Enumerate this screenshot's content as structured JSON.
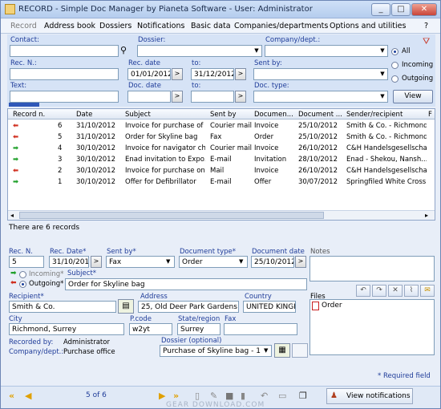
{
  "window": {
    "title": "RECORD - Simple Doc Manager by Pianeta Software - User: Administrator",
    "min": "_",
    "max": "□",
    "close": "✕"
  },
  "menu": [
    "Record",
    "Address book",
    "Dossiers",
    "Notifications",
    "Basic data",
    "Companies/departments",
    "Options and utilities",
    "?"
  ],
  "filter": {
    "contact_label": "Contact:",
    "dossier_label": "Dossier:",
    "company_label": "Company/dept.:",
    "recn_label": "Rec. N.:",
    "recdate_label": "Rec. date",
    "to_label": "to:",
    "sentby_label": "Sent by:",
    "text_label": "Text:",
    "docdate_label": "Doc. date",
    "to_label2": "to:",
    "doctype_label": "Doc. type:",
    "recdate_from": "01/01/2012",
    "recdate_to": "31/12/2012",
    "radio_all": "All",
    "radio_incoming": "Incoming",
    "radio_outgoing": "Outgoing",
    "view_button": "View"
  },
  "grid": {
    "columns": [
      "Record n.",
      "Date",
      "Subject",
      "Sent by",
      "Documen...",
      "Document ...",
      "Sender/recipient",
      "F"
    ],
    "rows": [
      {
        "dir": "out",
        "n": "6",
        "date": "31/10/2012",
        "subject": "Invoice for purchase of ...",
        "sentby": "Courier mail",
        "doctype": "Invoice",
        "docdate": "25/10/2012",
        "sender": "Smith & Co. - Richmond..."
      },
      {
        "dir": "out",
        "n": "5",
        "date": "31/10/2012",
        "subject": "Order for Skyline bag",
        "sentby": "Fax",
        "doctype": "Order",
        "docdate": "25/10/2012",
        "sender": "Smith & Co. - Richmond..."
      },
      {
        "dir": "in",
        "n": "4",
        "date": "30/10/2012",
        "subject": "Invoice for navigator ch...",
        "sentby": "Courier mail",
        "doctype": "Invoice",
        "docdate": "26/10/2012",
        "sender": "C&H Handelsgesellscha..."
      },
      {
        "dir": "in",
        "n": "3",
        "date": "30/10/2012",
        "subject": "Enad invitation to Expo...",
        "sentby": "E-mail",
        "doctype": "Invitation",
        "docdate": "28/10/2012",
        "sender": "Enad - Shekou, Nansh..."
      },
      {
        "dir": "out",
        "n": "2",
        "date": "30/10/2012",
        "subject": "Invoice for purchase on ...",
        "sentby": "Mail",
        "doctype": "Invoice",
        "docdate": "26/10/2012",
        "sender": "C&H Handelsgesellscha..."
      },
      {
        "dir": "in",
        "n": "1",
        "date": "30/10/2012",
        "subject": "Offer for Defibrillator",
        "sentby": "E-mail",
        "doctype": "Offer",
        "docdate": "30/07/2012",
        "sender": "Springfiled White Cross ..."
      }
    ],
    "count_text": "There are 6 records"
  },
  "detail": {
    "recn_label": "Rec. N.",
    "recn": "5",
    "recdate_label": "Rec. Date*",
    "recdate": "31/10/2012",
    "sentby_label": "Sent by*",
    "sentby": "Fax",
    "doctype_label": "Document type*",
    "doctype": "Order",
    "docdate_label": "Document date",
    "docdate": "25/10/2012",
    "notes_label": "Notes",
    "incoming": "Incoming*",
    "outgoing": "Outgoing*",
    "subject_label": "Subject*",
    "subject": "Order for Skyline bag",
    "recipient_label": "Recipient*",
    "recipient": "Smith & Co.",
    "address_label": "Address",
    "address": "25, Old Deer Park Gardens",
    "country_label": "Country",
    "country": "UNITED KINGD",
    "files_label": "Files",
    "file1": "Order",
    "city_label": "City",
    "city": "Richmond, Surrey",
    "pcode_label": "P.code",
    "pcode": "w2yt",
    "state_label": "State/region",
    "state": "Surrey",
    "fax_label": "Fax",
    "fax": "",
    "recordedby_label": "Recorded by:",
    "recordedby": "Administrator",
    "company_label": "Company/dept.:",
    "company": "Purchase office",
    "dossier_label": "Dossier (optional)",
    "dossier": "Purchase of Skyline bag - 1",
    "required": "* Required field"
  },
  "nav": {
    "position": "5 of 6",
    "notifications_button": "View notifications",
    "watermark": "GEAR DOWNLOAD.COM"
  }
}
